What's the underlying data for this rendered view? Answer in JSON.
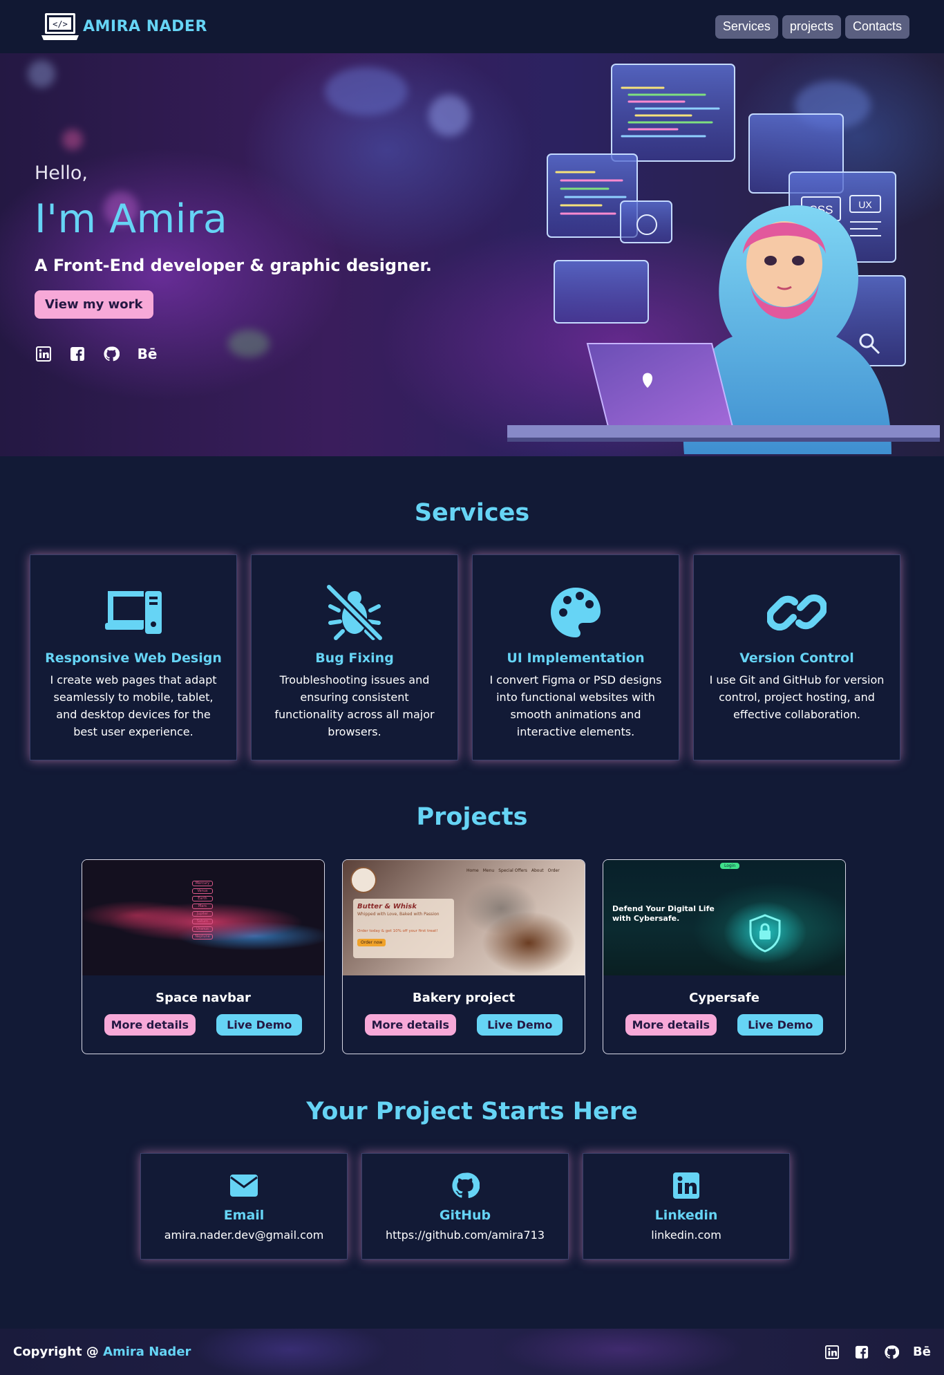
{
  "navbar": {
    "brand": "AMIRA NADER",
    "links": [
      "Services",
      "projects",
      "Contacts"
    ]
  },
  "hero": {
    "hello": "Hello,",
    "name": "I'm Amira",
    "role": "A Front-End developer & graphic designer.",
    "cta": "View my work",
    "socials": [
      "linkedin-icon",
      "facebook-icon",
      "github-icon",
      "behance-icon"
    ],
    "illustration_labels": [
      "CSS",
      "UX"
    ]
  },
  "services": {
    "title": "Services",
    "cards": [
      {
        "icon": "devices-icon",
        "title": "Responsive Web Design",
        "desc": "I create web pages that adapt seamlessly to mobile, tablet, and desktop devices for the best user experience."
      },
      {
        "icon": "bug-slash-icon",
        "title": "Bug Fixing",
        "desc": "Troubleshooting issues and ensuring consistent functionality across all major browsers."
      },
      {
        "icon": "palette-icon",
        "title": "UI Implementation",
        "desc": "I convert Figma or PSD designs into functional websites with smooth animations and interactive elements."
      },
      {
        "icon": "link-icon",
        "title": "Version Control",
        "desc": "I use Git and GitHub for version control, project hosting, and effective collaboration."
      }
    ]
  },
  "projects": {
    "title": "Projects",
    "items": [
      {
        "name": "Space navbar",
        "more": "More details",
        "demo": "Live Demo"
      },
      {
        "name": "Bakery project",
        "more": "More details",
        "demo": "Live Demo"
      },
      {
        "name": "Cypersafe",
        "more": "More details",
        "demo": "Live Demo"
      }
    ],
    "thumbs": {
      "space_menu": [
        "Mercury",
        "Venus",
        "Earth",
        "Mars",
        "Jupiter",
        "Saturn",
        "Uranus",
        "Neptune"
      ],
      "bakery_nav": [
        "Home",
        "Menu",
        "Special Offers",
        "About",
        "Order"
      ],
      "bakery_heading": "Butter & Whisk",
      "bakery_sub": "Whipped with Love, Baked with Passion",
      "bakery_offer": "Order today & get 10% off your first treat!",
      "bakery_btn": "Order now",
      "cyber_heading": "Defend Your Digital Life with Cybersafe.",
      "cyber_btn": "Login"
    }
  },
  "contact": {
    "title": "Your Project Starts Here",
    "cards": [
      {
        "icon": "envelope-icon",
        "title": "Email",
        "value": "amira.nader.dev@gmail.com"
      },
      {
        "icon": "github-icon",
        "title": "GitHub",
        "value": "https://github.com/amira713"
      },
      {
        "icon": "linkedin-icon",
        "title": "Linkedin",
        "value": "linkedin.com"
      }
    ]
  },
  "footer": {
    "copy_prefix": "Copyright @ ",
    "copy_name": "Amira Nader",
    "socials": [
      "linkedin-icon",
      "facebook-icon",
      "github-icon",
      "behance-icon"
    ]
  },
  "colors": {
    "background": "#121a36",
    "accent": "#66d4f5",
    "pink": "#f7a9d8",
    "nav_button": "#5a5f80"
  }
}
